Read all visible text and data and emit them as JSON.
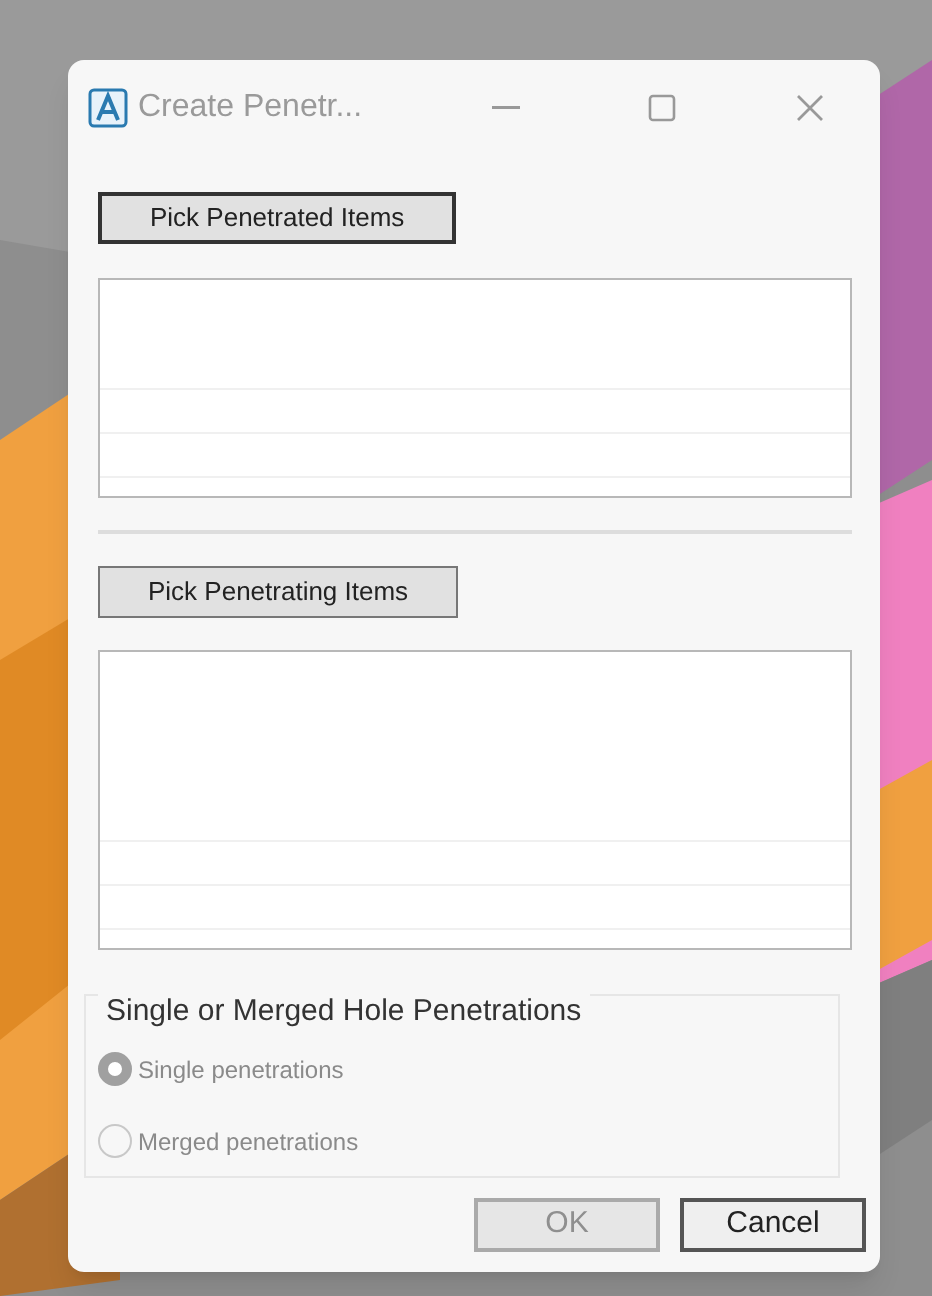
{
  "window": {
    "title": "Create Penetr..."
  },
  "sections": [
    {
      "button": {
        "label": "Pick Penetrated Items",
        "focused": true
      }
    },
    {
      "button": {
        "label": "Pick Penetrating Items",
        "focused": false
      }
    }
  ],
  "group": {
    "title": "Single or Merged Hole Penetrations",
    "options": [
      {
        "label": "Single penetrations",
        "selected": true,
        "disabled": true
      },
      {
        "label": "Merged penetrations",
        "selected": false,
        "disabled": true
      }
    ]
  },
  "buttons": [
    {
      "label": "OK",
      "disabled": true
    },
    {
      "label": "Cancel",
      "disabled": false
    }
  ]
}
